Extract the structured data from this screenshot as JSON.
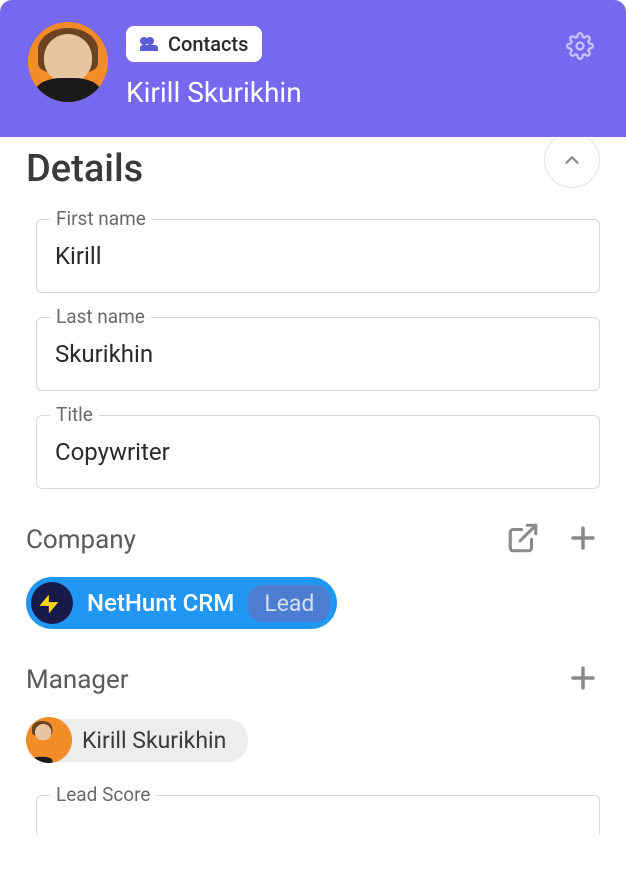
{
  "header": {
    "badge_label": "Contacts",
    "contact_name": "Kirill Skurikhin"
  },
  "details": {
    "section_title": "Details",
    "fields": {
      "first_name": {
        "label": "First name",
        "value": "Kirill"
      },
      "last_name": {
        "label": "Last name",
        "value": "Skurikhin"
      },
      "title": {
        "label": "Title",
        "value": "Copywriter"
      }
    },
    "company": {
      "label": "Company",
      "name": "NetHunt CRM",
      "status": "Lead"
    },
    "manager": {
      "label": "Manager",
      "name": "Kirill Skurikhin"
    },
    "lead_score": {
      "label": "Lead Score"
    }
  }
}
